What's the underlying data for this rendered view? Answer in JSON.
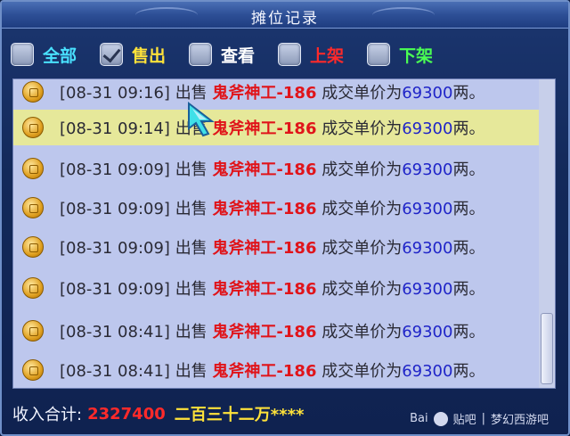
{
  "window": {
    "title": "摊位记录"
  },
  "filters": [
    {
      "label": "全部",
      "checked": false,
      "color": "#49e1ff"
    },
    {
      "label": "售出",
      "checked": true,
      "color": "#ffe23a"
    },
    {
      "label": "查看",
      "checked": false,
      "color": "#ffffff"
    },
    {
      "label": "上架",
      "checked": false,
      "color": "#ff2a2a"
    },
    {
      "label": "下架",
      "checked": false,
      "color": "#4bff53"
    }
  ],
  "records": [
    {
      "time": "[08-31 09:16]",
      "action": "出售",
      "item": "鬼斧神工-186",
      "middle": "成交单价为",
      "price": "69300",
      "unit": "两。",
      "selected": false
    },
    {
      "time": "[08-31 09:14]",
      "action": "出售",
      "item": "鬼斧神工-186",
      "middle": "成交单价为",
      "price": "69300",
      "unit": "两。",
      "selected": true
    },
    {
      "time": "[08-31 09:09]",
      "action": "出售",
      "item": "鬼斧神工-186",
      "middle": "成交单价为",
      "price": "69300",
      "unit": "两。",
      "selected": false
    },
    {
      "time": "[08-31 09:09]",
      "action": "出售",
      "item": "鬼斧神工-186",
      "middle": "成交单价为",
      "price": "69300",
      "unit": "两。",
      "selected": false
    },
    {
      "time": "[08-31 09:09]",
      "action": "出售",
      "item": "鬼斧神工-186",
      "middle": "成交单价为",
      "price": "69300",
      "unit": "两。",
      "selected": false
    },
    {
      "time": "[08-31 09:09]",
      "action": "出售",
      "item": "鬼斧神工-186",
      "middle": "成交单价为",
      "price": "69300",
      "unit": "两。",
      "selected": false
    },
    {
      "time": "[08-31 08:41]",
      "action": "出售",
      "item": "鬼斧神工-186",
      "middle": "成交单价为",
      "price": "69300",
      "unit": "两。",
      "selected": false
    },
    {
      "time": "[08-31 08:41]",
      "action": "出售",
      "item": "鬼斧神工-186",
      "middle": "成交单价为",
      "price": "69300",
      "unit": "两。",
      "selected": false
    }
  ],
  "footer": {
    "label": "收入合计:",
    "value": "2327400",
    "words": "二百三十二万****"
  },
  "watermark": {
    "brand": "Bai",
    "bar": "贴吧",
    "forum": "梦幻西游吧"
  },
  "icons": {
    "record": "coin-icon",
    "cursor": "cursor-icon",
    "close": "close-icon"
  }
}
